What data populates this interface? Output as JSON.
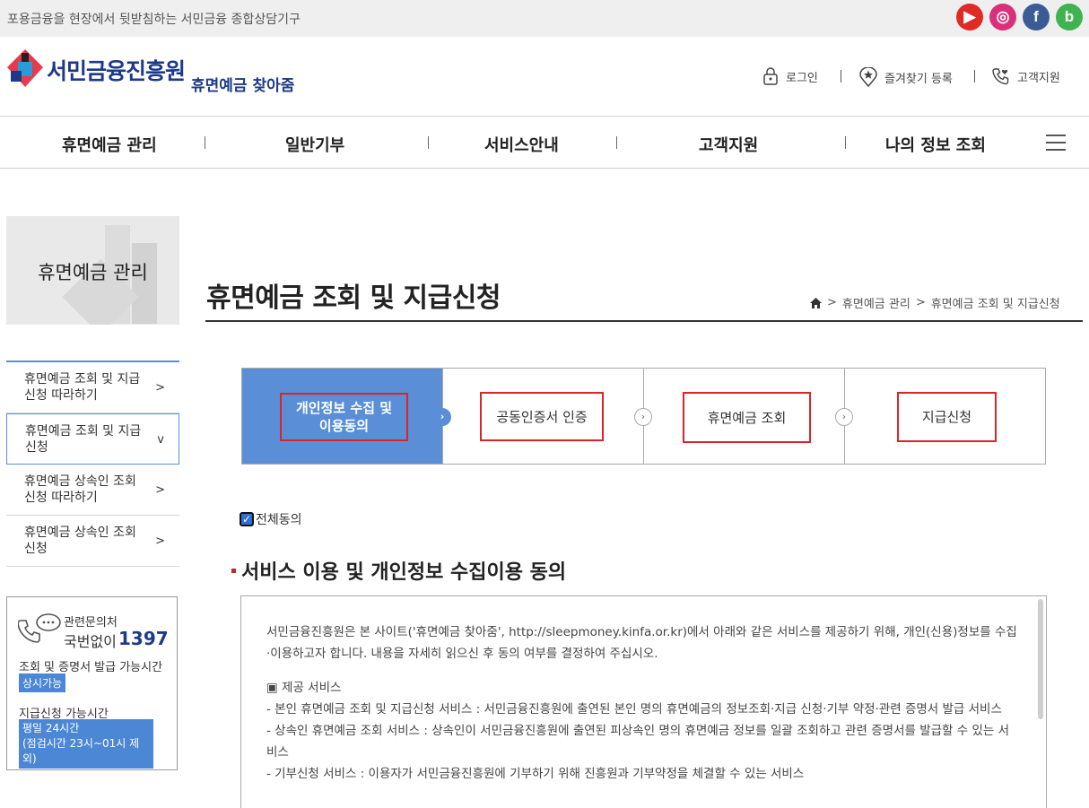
{
  "topbar": {
    "slogan": "포용금융을 현장에서 뒷받침하는 서민금융 종합상담기구",
    "sns": [
      {
        "name": "youtube",
        "glyph": "▶",
        "color": "#e02a25"
      },
      {
        "name": "instagram",
        "glyph": "◎",
        "color": "#d8317a"
      },
      {
        "name": "facebook",
        "glyph": "f",
        "color": "#3b5b97"
      },
      {
        "name": "blog",
        "glyph": "b",
        "color": "#3fb34f"
      }
    ]
  },
  "header": {
    "logo": "서민금융진흥원",
    "logo_sub": "휴면예금 찾아줌",
    "login": "로그인",
    "favorite": "즐겨찾기 등록",
    "customer": "고객지원"
  },
  "gnb": {
    "items": [
      "휴면예금 관리",
      "일반기부",
      "서비스안내",
      "고객지원",
      "나의 정보 조회"
    ]
  },
  "lnb": {
    "title": "휴면예금 관리",
    "items": [
      {
        "label": "휴면예금 조회 및 지급신청 따라하기",
        "arrow": ">"
      },
      {
        "label": "휴면예금 조회 및 지급신청",
        "arrow": "v"
      },
      {
        "label": "휴면예금 상속인 조회신청 따라하기",
        "arrow": ">"
      },
      {
        "label": "휴면예금 상속인 조회신청",
        "arrow": ">"
      }
    ]
  },
  "contact": {
    "label1": "관련문의처",
    "label2": "국번없이",
    "number": "1397",
    "section1": "조회 및 증명서 발급 가능시간",
    "badge1": "상시가능",
    "section2": "지급신청 가능시간",
    "badge2_line1": "평일 24시간",
    "badge2_line2": "(점검시간 23시~01시 제외)"
  },
  "main": {
    "page_title": "휴면예금 조회 및 지급신청",
    "breadcrumb": [
      "휴면예금 관리",
      "휴면예금 조회 및 지급신청"
    ],
    "steps": [
      {
        "line1": "개인정보 수집 및",
        "line2": "이용동의",
        "active": true
      },
      {
        "line1": "공동인증서 인증",
        "line2": "",
        "active": false
      },
      {
        "line1": "휴면예금 조회",
        "line2": "",
        "active": false
      },
      {
        "line1": "지급신청",
        "line2": "",
        "active": false
      }
    ],
    "agree_all": "전체동의",
    "section_title": "서비스 이용 및 개인정보 수집이용 동의",
    "terms": {
      "intro": "서민금융진흥원은 본 사이트('휴면예금 찾아줌', http://sleepmoney.kinfa.or.kr)에서 아래와 같은 서비스를 제공하기 위해, 개인(신용)정보를 수집·이용하고자 합니다. 내용을 자세히 읽으신 후 동의 여부를 결정하여 주십시오.",
      "heading": "▣ 제공 서비스",
      "line1": "- 본인 휴면예금 조회 및 지급신청 서비스 : 서민금융진흥원에 출연된 본인 명의 휴면예금의 정보조회·지급 신청·기부 약정·관련 증명서 발급 서비스",
      "line2": "- 상속인 휴면예금 조회 서비스 : 상속인이 서민금융진흥원에 출연된 피상속인 명의 휴면예금 정보를 일괄 조회하고 관련 증명서를 발급할 수 있는 서비스",
      "line3": "- 기부신청 서비스 : 이용자가 서민금융진흥원에 기부하기 위해 진흥원과 기부약정을 체결할 수 있는 서비스"
    }
  }
}
